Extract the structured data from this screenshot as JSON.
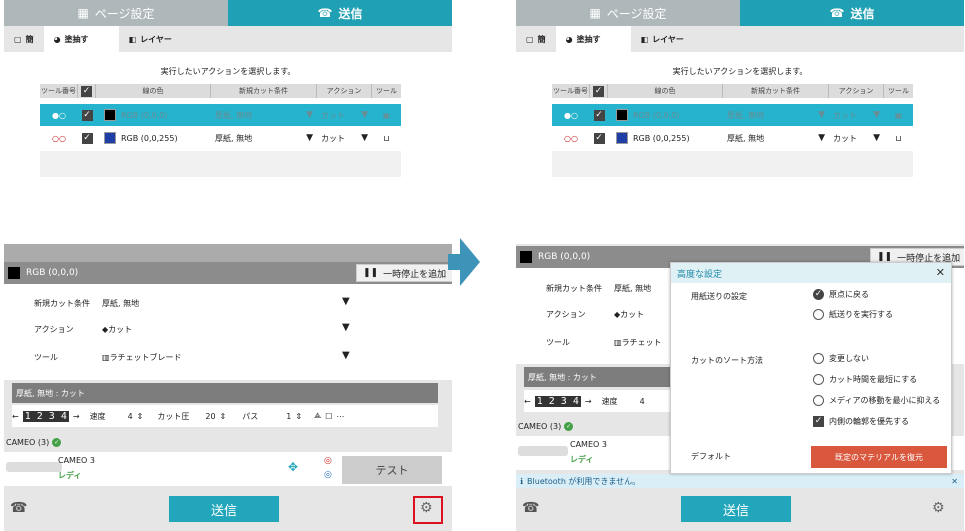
{
  "tabs": {
    "page_setup": "ページ設定",
    "send": "送信"
  },
  "subtabs": {
    "simple": "簡",
    "fill": "塗抽す",
    "layer": "レイヤー"
  },
  "instruction": "実行したいアクションを選択します。",
  "table_headers": [
    "ツール番号",
    "",
    "線の色",
    "新規カット条件",
    "アクション",
    "ツール"
  ],
  "rows": [
    {
      "color": "RGB (0,0,0)",
      "swatch": "#000000",
      "condition": "厚紙, 無地",
      "action": "カット",
      "selected": true
    },
    {
      "color": "RGB (0,0,255)",
      "swatch": "#1f3fa8",
      "condition": "厚紙, 無地",
      "action": "カット",
      "selected": false
    }
  ],
  "current_color": "RGB (0,0,0)",
  "pause_label": "一時停止を追加",
  "pause_label_short": "一時停止を追加",
  "fields": {
    "condition_label": "新規カット条件",
    "condition_value": "厚紙, 無地",
    "action_label": "アクション",
    "action_value": "カット",
    "tool_label": "ツール",
    "tool_value": "ラチェットブレード",
    "tool_value_short": "ラチェット"
  },
  "material_bar": "厚紙, 無地 : カット",
  "controls": {
    "digits": "1 2 3 4",
    "speed_label": "速度",
    "speed": "4",
    "force_label": "カット圧",
    "force": "20",
    "pass_label": "パス",
    "pass": "1"
  },
  "device": {
    "section": "CAMEO (3)",
    "name": "CAMEO 3",
    "status": "レディ"
  },
  "test_button": "テスト",
  "send_button": "送信",
  "dialog": {
    "title": "高度な設定",
    "feed_label": "用紙送りの設定",
    "feed_options": [
      "原点に戻る",
      "紙送りを実行する"
    ],
    "sort_label": "カットのソート方法",
    "sort_options": [
      "変更しない",
      "カット時間を最短にする",
      "メディアの移動を最小に抑える",
      "内側の輪郭を優先する"
    ],
    "default_label": "デフォルト",
    "reset_button": "既定のマテリアルを復元"
  },
  "bluetooth_msg": "Bluetooth が利用できません。",
  "colors": {
    "accent": "#21a6bb",
    "selected_row": "#26b3cd",
    "reset": "#d9573d",
    "arrow": "#3e94b8"
  }
}
